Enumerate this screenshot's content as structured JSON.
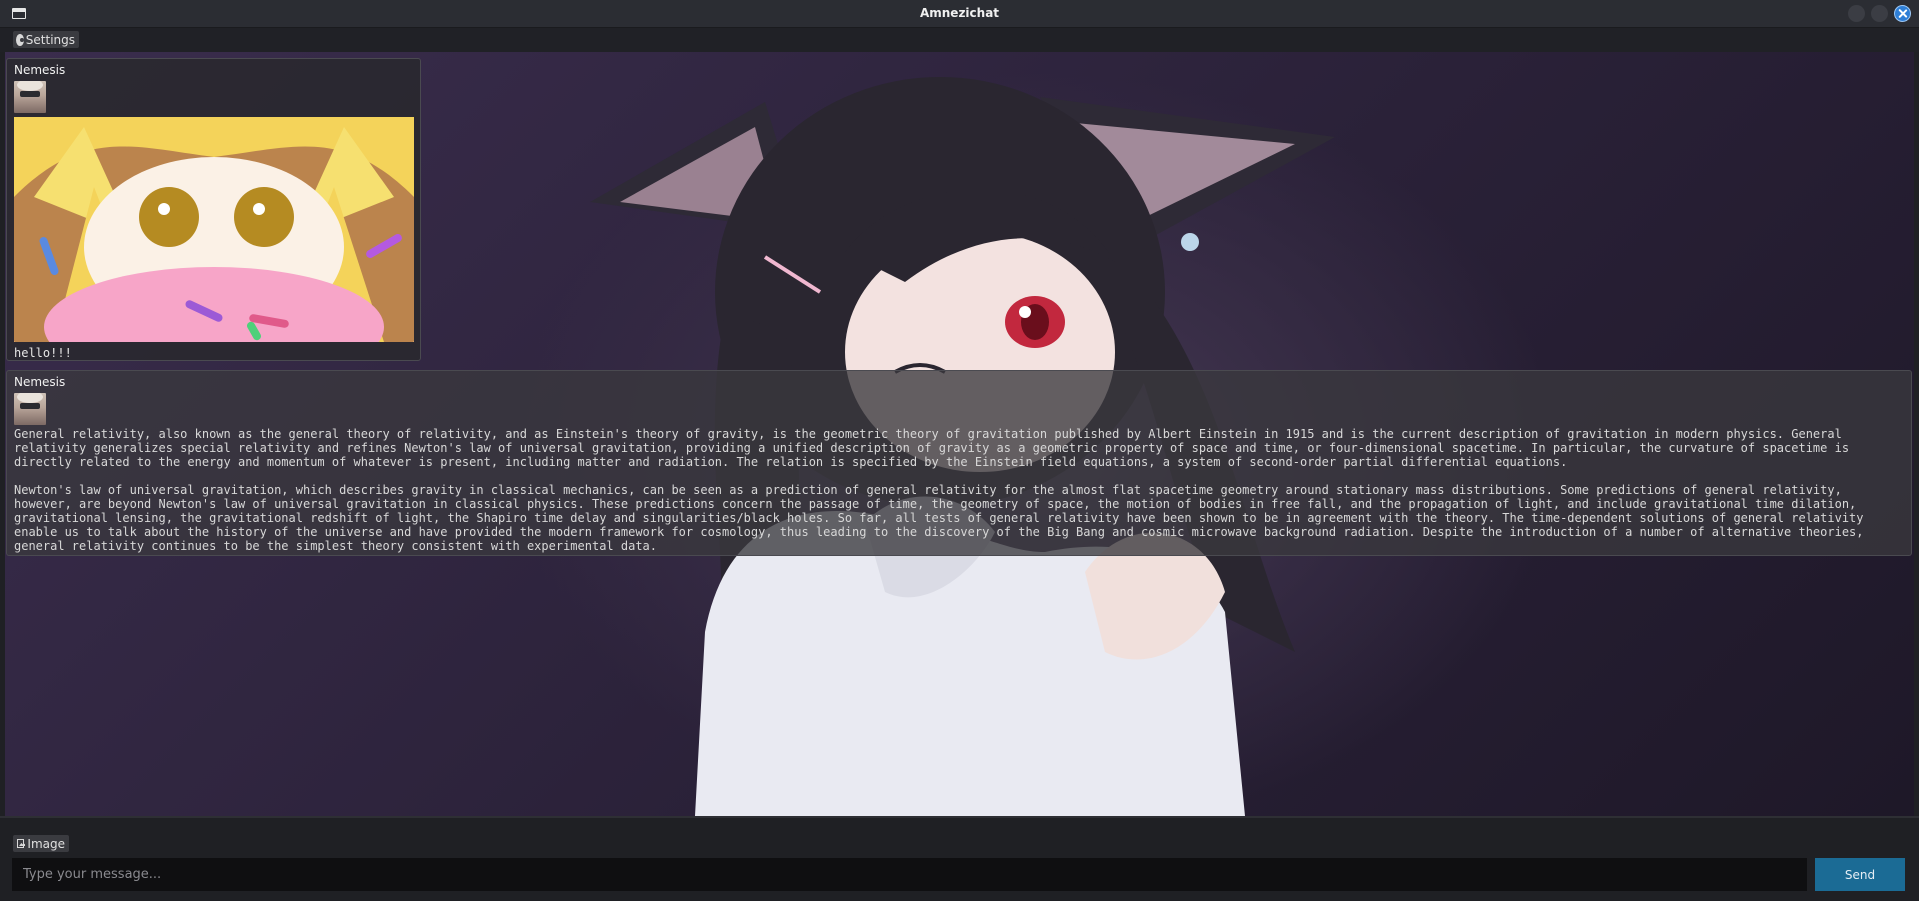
{
  "window": {
    "title": "Amnezichat",
    "icon": "app-window-icon",
    "controls": [
      "minimize-icon",
      "maximize-icon",
      "close-icon"
    ],
    "accent_color": "#2f7fd6"
  },
  "menubar": {
    "settings_label": "Settings",
    "settings_icon": "gear-icon"
  },
  "messages": [
    {
      "sender": "Nemesis",
      "text": "hello!!!",
      "has_image": true
    },
    {
      "sender": "Nemesis",
      "text": "General relativity, also known as the general theory of relativity, and as Einstein's theory of gravity, is the geometric theory of gravitation published by Albert Einstein in 1915 and is the current description of gravitation in modern physics. General relativity generalizes special relativity and refines Newton's law of universal gravitation, providing a unified description of gravity as a geometric property of space and time, or four-dimensional spacetime. In particular, the curvature of spacetime is directly related to the energy and momentum of whatever is present, including matter and radiation. The relation is specified by the Einstein field equations, a system of second-order partial differential equations.\n\nNewton's law of universal gravitation, which describes gravity in classical mechanics, can be seen as a prediction of general relativity for the almost flat spacetime geometry around stationary mass distributions. Some predictions of general relativity, however, are beyond Newton's law of universal gravitation in classical physics. These predictions concern the passage of time, the geometry of space, the motion of bodies in free fall, and the propagation of light, and include gravitational time dilation, gravitational lensing, the gravitational redshift of light, the Shapiro time delay and singularities/black holes. So far, all tests of general relativity have been shown to be in agreement with the theory. The time-dependent solutions of general relativity enable us to talk about the history of the universe and have provided the modern framework for cosmology, thus leading to the discovery of the Big Bang and cosmic microwave background radiation. Despite the introduction of a number of alternative theories, general relativity continues to be the simplest theory consistent with experimental data.",
      "has_image": false
    }
  ],
  "composer": {
    "image_label": "Image",
    "image_icon": "image-icon",
    "placeholder": "Type your message...",
    "value": "",
    "send_label": "Send",
    "send_color": "#1b6b95"
  }
}
